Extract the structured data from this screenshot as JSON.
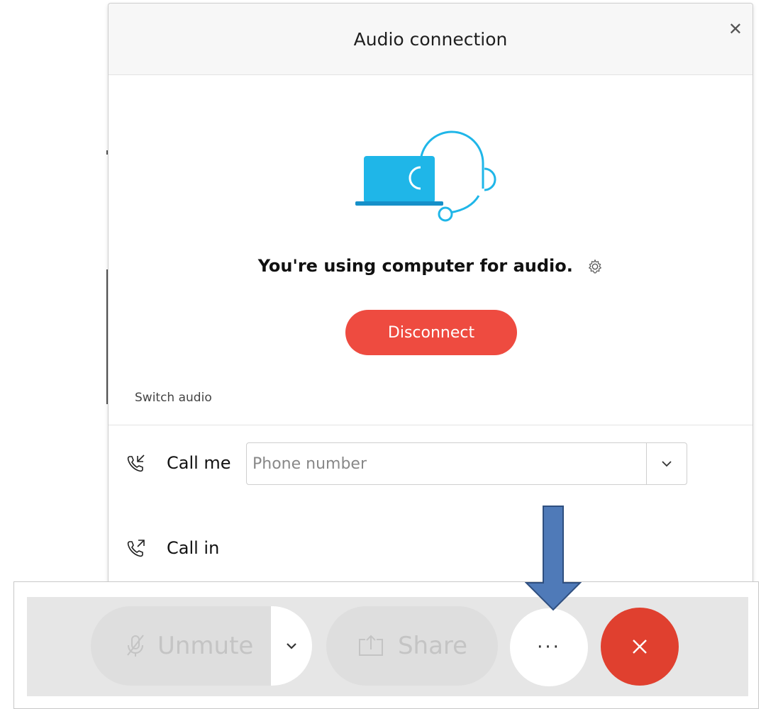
{
  "dialog": {
    "title": "Audio connection",
    "close_icon": "close-icon",
    "status_text": "You're using computer for audio.",
    "settings_icon": "gear-icon",
    "disconnect_label": "Disconnect",
    "switch_audio_label": "Switch audio",
    "call_me": {
      "icon": "phone-incoming-icon",
      "label": "Call me",
      "placeholder": "Phone number",
      "value": ""
    },
    "call_in": {
      "icon": "phone-outgoing-icon",
      "label": "Call in"
    }
  },
  "toolbar": {
    "unmute_label": "Unmute",
    "share_label": "Share",
    "more_label": "···"
  },
  "colors": {
    "disconnect": "#ee4b40",
    "leave": "#e0402f",
    "illustration": "#1fb6e8",
    "annotation_arrow": "#4f7ab8"
  }
}
